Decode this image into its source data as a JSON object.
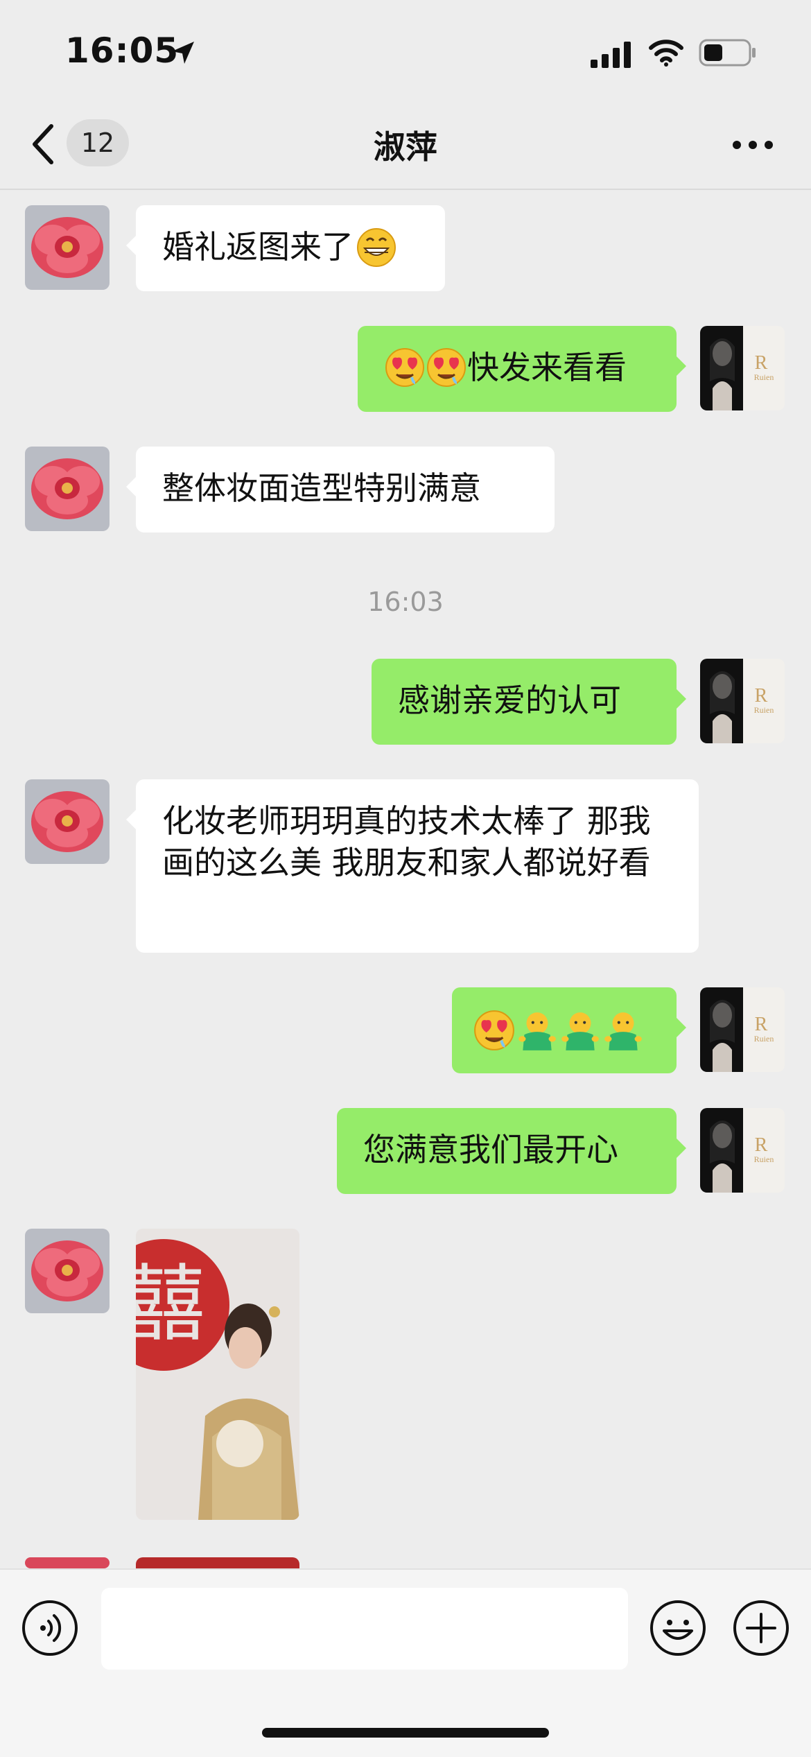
{
  "status_bar": {
    "time": "16:05"
  },
  "header": {
    "back_count": "12",
    "title": "淑萍"
  },
  "messages": [
    {
      "text": "婚礼返图来了"
    },
    {
      "text": "快发来看看"
    },
    {
      "text": "整体妆面造型特别满意"
    },
    {
      "text": "16:03"
    },
    {
      "text": "感谢亲爱的认可"
    },
    {
      "text": "化妆老师玥玥真的技术太棒了 那我画的这么美 我朋友和家人都说好看"
    },
    {
      "text": ""
    },
    {
      "text": "您满意我们最开心"
    }
  ],
  "image_message": {
    "red_symbol": "囍"
  },
  "my_avatar": {
    "logo_text": "Ruien"
  },
  "colors": {
    "background": "#ededed",
    "outgoing_bubble": "#95ec69",
    "incoming_bubble": "#ffffff"
  },
  "icons": [
    "location-arrow-icon",
    "signal-icon",
    "wifi-icon",
    "battery-icon",
    "chevron-left-icon",
    "more-icon",
    "voice-icon",
    "emoji-icon",
    "plus-icon"
  ]
}
